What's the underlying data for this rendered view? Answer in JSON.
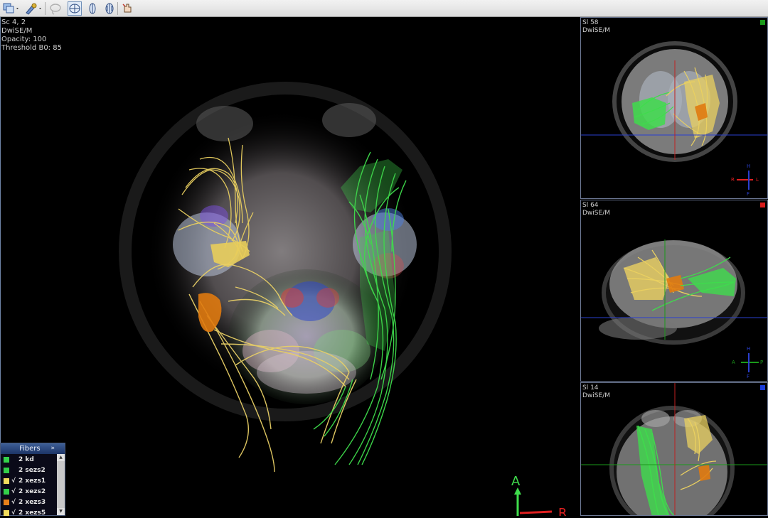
{
  "toolbar": {
    "tools": [
      "layers-icon",
      "pen-icon",
      "lasso-icon",
      "axial-view-icon",
      "coronal-view-icon",
      "sagittal-view-icon",
      "hand-icon"
    ]
  },
  "main_view": {
    "info": [
      "Sc 4, 2",
      "DwiSE/M",
      "Opacity: 100",
      "Threshold B0: 85"
    ],
    "orientation": {
      "up": "A",
      "right": "R"
    }
  },
  "panes": [
    {
      "slice": "Sl 58",
      "series": "DwiSE/M",
      "marker_color": "#1a9a1a",
      "orient": {
        "top": "H",
        "left": "R",
        "right": "L",
        "bottom": "F"
      }
    },
    {
      "slice": "Sl 64",
      "series": "DwiSE/M",
      "marker_color": "#d81b1b",
      "orient": {
        "top": "H",
        "left": "A",
        "right": "P",
        "bottom": "F"
      }
    },
    {
      "slice": "Sl 14",
      "series": "DwiSE/M",
      "marker_color": "#1a3cd8"
    }
  ],
  "fibers_panel": {
    "title": "Fibers",
    "expand": "»",
    "items": [
      {
        "checked": "",
        "label": "2 kd",
        "color": "#33d04a"
      },
      {
        "checked": "",
        "label": "2 sezs2",
        "color": "#33d04a"
      },
      {
        "checked": "√",
        "label": "2 xezs1",
        "color": "#f2dc5d"
      },
      {
        "checked": "√",
        "label": "2 xezs2",
        "color": "#33d04a"
      },
      {
        "checked": "√",
        "label": "2 xezs3",
        "color": "#e8801a"
      },
      {
        "checked": "√",
        "label": "2 xezs5",
        "color": "#f2dc5d"
      }
    ]
  },
  "colors": {
    "yellow_tract": "#eed56a",
    "green_tract": "#3fdc4c",
    "orange_tract": "#e27a10",
    "accent": "#3e5f97"
  }
}
